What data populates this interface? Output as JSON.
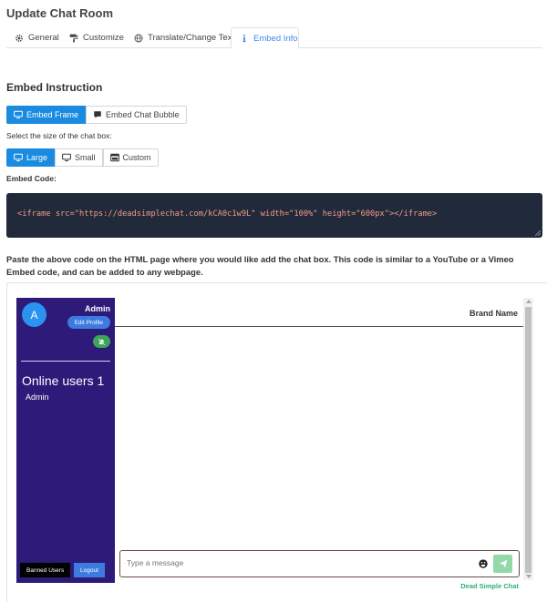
{
  "page": {
    "title": "Update Chat Room"
  },
  "tabs": [
    {
      "label": "General",
      "icon": "gear-icon"
    },
    {
      "label": "Customize",
      "icon": "paint-roller-icon"
    },
    {
      "label": "Translate/Change Text",
      "icon": "globe-icon"
    },
    {
      "label": "Embed Info",
      "icon": "info-icon",
      "active": true
    }
  ],
  "embed": {
    "heading": "Embed Instruction",
    "type_options": [
      {
        "label": "Embed Frame",
        "icon": "monitor-icon",
        "active": true
      },
      {
        "label": "Embed Chat Bubble",
        "icon": "comment-icon",
        "active": false
      }
    ],
    "size_label": "Select the size of the chat box:",
    "size_options": [
      {
        "label": "Large",
        "icon": "monitor-icon",
        "active": true
      },
      {
        "label": "Small",
        "icon": "monitor-icon",
        "active": false
      },
      {
        "label": "Custom",
        "icon": "window-icon",
        "active": false
      }
    ],
    "code_label": "Embed Code:",
    "code": "<iframe src=\"https://deadsimplechat.com/kCA0c1w9L\" width=\"100%\" height=\"600px\"></iframe>",
    "note": "Paste the above code on the HTML page where you would like add the chat box. This code is similar to a YouTube or a Vimeo Embed code, and can be added to any webpage."
  },
  "preview": {
    "avatar_letter": "A",
    "admin_name": "Admin",
    "edit_profile_label": "Edit Profile",
    "online_title": "Online users 1",
    "online_users": [
      "Admin"
    ],
    "banned_users_label": "Banned Users",
    "logout_label": "Logout",
    "brand_name": "Brand Name",
    "message_placeholder": "Type a message",
    "footer_brand": "Dead Simple Chat"
  },
  "colors": {
    "accent": "#1a8be0",
    "sidebar": "#2d1a79",
    "code_bg": "#212a3a",
    "code_text": "#f59a8a",
    "send_button": "#93d9a8",
    "footer_brand": "#2cb07a"
  }
}
